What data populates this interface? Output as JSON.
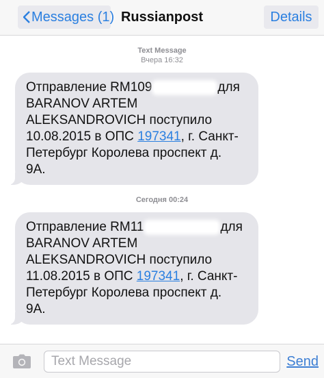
{
  "nav": {
    "back_label": "Messages (1)",
    "title": "Russianpost",
    "details_label": "Details"
  },
  "thread": {
    "stamp1_kind": "Text Message",
    "stamp1_time": "Вчера 16:32",
    "stamp2_time": "Сегодня 00:24",
    "messages": [
      {
        "l1_prefix": "Отправление RM109",
        "l1_suffix": "для",
        "l2": "BARANOV ARTEM",
        "l3": "ALEKSANDROVICH поступило",
        "l4_prefix": "10.08.2015 в ОПС ",
        "l4_link": "197341",
        "l4_suffix": ", г. Санкт-",
        "l5": "Петербург Королева проспект д.",
        "l6": "9А."
      },
      {
        "l1_prefix": "Отправление RM11",
        "l1_suffix": "для",
        "l2": "BARANOV ARTEM",
        "l3": "ALEKSANDROVICH поступило",
        "l4_prefix": "11.08.2015 в ОПС ",
        "l4_link": "197341",
        "l4_suffix": ", г. Санкт-",
        "l5": "Петербург Королева проспект д.",
        "l6": "9А."
      }
    ]
  },
  "composer": {
    "placeholder": "Text Message",
    "send_label": "Send"
  },
  "colors": {
    "accent": "#2a7fe0",
    "bubble": "#e5e5ea"
  }
}
